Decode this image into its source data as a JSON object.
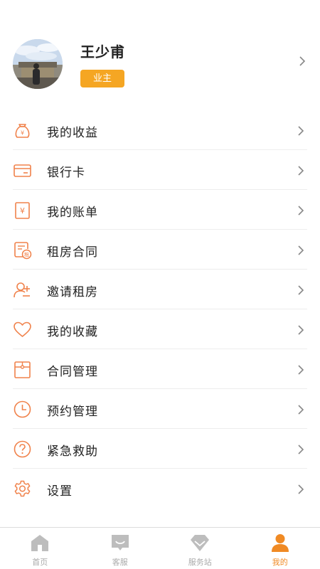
{
  "profile": {
    "name": "王少甫",
    "role_badge": "业主"
  },
  "menu": {
    "items": [
      {
        "label": "我的收益",
        "icon": "money-bag-icon"
      },
      {
        "label": "银行卡",
        "icon": "bank-card-icon"
      },
      {
        "label": "我的账单",
        "icon": "bill-icon"
      },
      {
        "label": "租房合同",
        "icon": "rent-contract-icon"
      },
      {
        "label": "邀请租房",
        "icon": "invite-user-icon"
      },
      {
        "label": "我的收藏",
        "icon": "heart-icon"
      },
      {
        "label": "合同管理",
        "icon": "contract-folder-icon"
      },
      {
        "label": "预约管理",
        "icon": "clock-icon"
      },
      {
        "label": "紧急救助",
        "icon": "question-icon"
      },
      {
        "label": "设置",
        "icon": "gear-icon"
      }
    ]
  },
  "tabbar": {
    "tabs": [
      {
        "label": "首页",
        "icon": "home-icon",
        "active": false
      },
      {
        "label": "客服",
        "icon": "chat-icon",
        "active": false
      },
      {
        "label": "服务站",
        "icon": "service-station-icon",
        "active": false
      },
      {
        "label": "我的",
        "icon": "person-icon",
        "active": true
      }
    ]
  },
  "colors": {
    "accent": "#f5a623",
    "icon_orange": "#f0824b",
    "tab_active": "#f08a24",
    "tab_inactive": "#b9b9b9"
  }
}
